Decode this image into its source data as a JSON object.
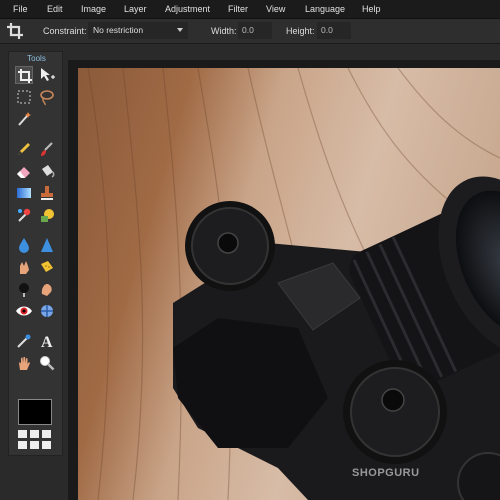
{
  "menu": {
    "items": [
      "File",
      "Edit",
      "Image",
      "Layer",
      "Adjustment",
      "Filter",
      "View",
      "Language",
      "Help"
    ]
  },
  "options": {
    "constraint_label": "Constraint:",
    "constraint_value": "No restriction",
    "width_label": "Width:",
    "width_value": "0.0",
    "height_label": "Height:",
    "height_value": "0.0"
  },
  "tools": {
    "title": "Tools",
    "items": [
      {
        "name": "crop-icon",
        "active": true
      },
      {
        "name": "move-icon"
      },
      {
        "name": "marquee-icon"
      },
      {
        "name": "lasso-icon"
      },
      {
        "name": "wand-icon"
      },
      {
        "name": "pencil-icon"
      },
      {
        "name": "brush-icon"
      },
      {
        "name": "eraser-icon"
      },
      {
        "name": "bucket-icon"
      },
      {
        "name": "gradient-icon"
      },
      {
        "name": "stamp-icon"
      },
      {
        "name": "colorpicker-icon"
      },
      {
        "name": "replace-color-icon"
      },
      {
        "name": "drop-icon"
      },
      {
        "name": "sharpen-icon"
      },
      {
        "name": "smudge-icon"
      },
      {
        "name": "sponge-icon"
      },
      {
        "name": "burn-icon"
      },
      {
        "name": "dodge-icon"
      },
      {
        "name": "redeye-icon"
      },
      {
        "name": "spot-heal-icon"
      },
      {
        "name": "eyedropper-icon"
      },
      {
        "name": "text-icon"
      },
      {
        "name": "hand-icon"
      },
      {
        "name": "zoom-icon"
      }
    ],
    "foreground_color": "#000000"
  },
  "canvas": {
    "watermark": "SHOPGURU"
  },
  "colors": {
    "accent": "#8fbfe0",
    "menubar": "#1b1b1b",
    "panel": "#333333"
  }
}
